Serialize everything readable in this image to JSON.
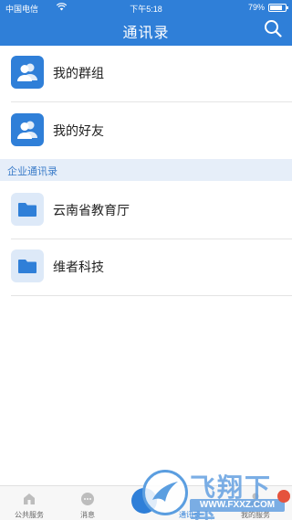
{
  "status_bar": {
    "carrier": "中国电信",
    "time": "下午5:18",
    "battery": "79%"
  },
  "header": {
    "title": "通讯录"
  },
  "groups": [
    {
      "label": "我的群组",
      "icon": "people-icon"
    },
    {
      "label": "我的好友",
      "icon": "people-icon"
    }
  ],
  "section": {
    "title": "企业通讯录"
  },
  "orgs": [
    {
      "label": "云南省教育厅",
      "icon": "folder-icon"
    },
    {
      "label": "维者科技",
      "icon": "folder-icon"
    }
  ],
  "tabbar": {
    "tabs": [
      {
        "label": "公共服务",
        "icon": "home-icon"
      },
      {
        "label": "消息",
        "icon": "chat-icon"
      },
      {
        "label": "通讯录",
        "icon": "contacts-icon",
        "active": true
      },
      {
        "label": "我的服务",
        "icon": "user-icon"
      }
    ]
  },
  "watermark": {
    "text": "飞翔下载",
    "url": "WWW.FXXZ.COM"
  },
  "colors": {
    "accent": "#2f7fd8",
    "section_bg": "#e6eef9",
    "icon_light": "#dde9f8"
  }
}
